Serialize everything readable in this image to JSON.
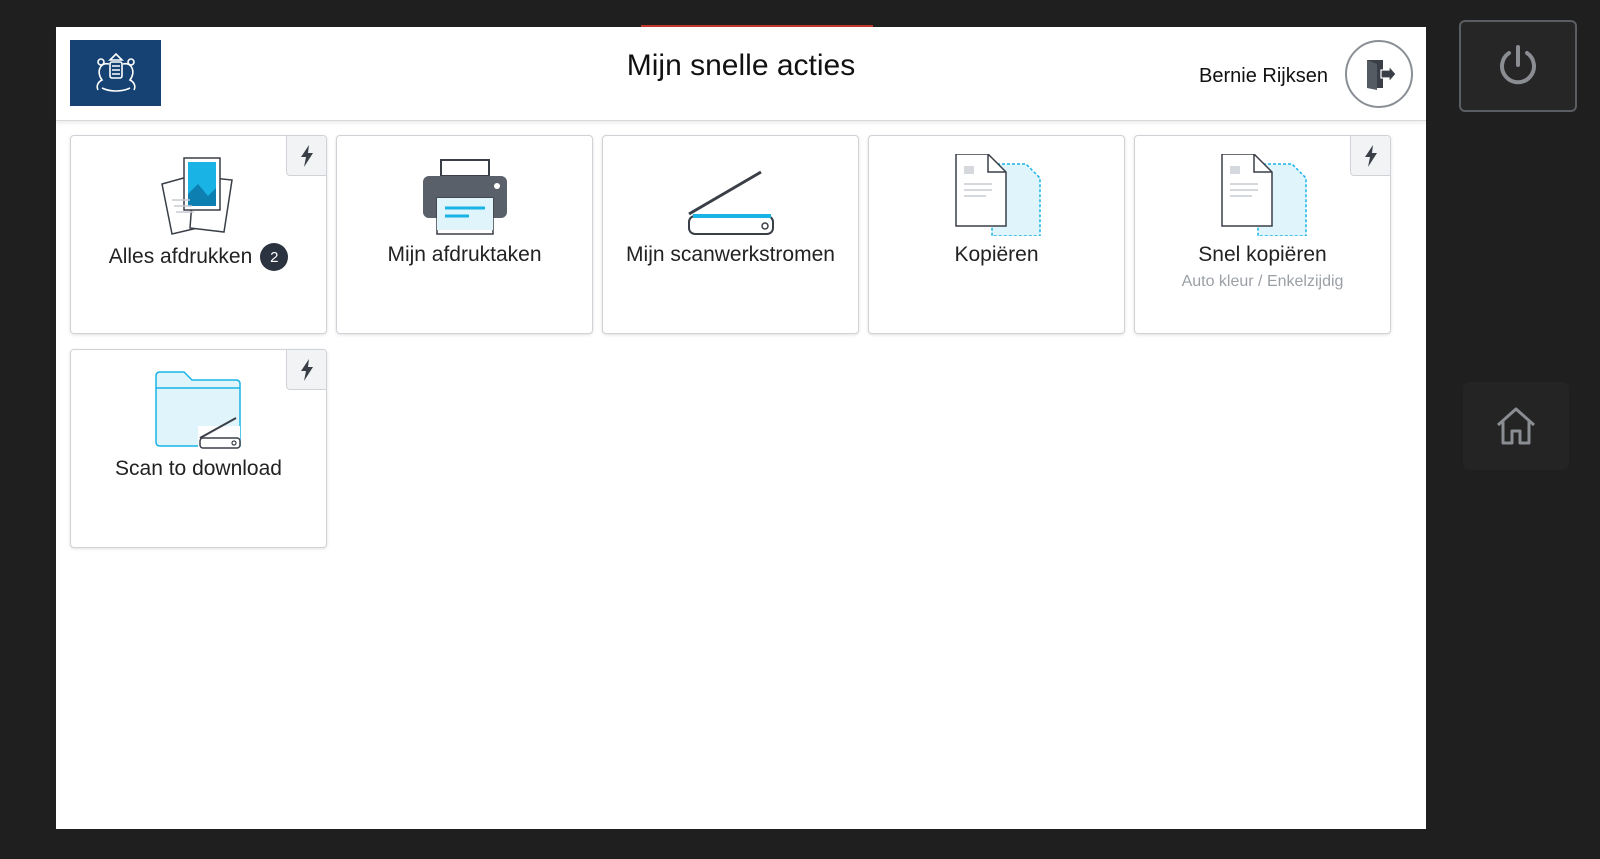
{
  "header": {
    "title": "Mijn snelle acties",
    "user_name": "Bernie Rijksen",
    "logo_icon": "coat-of-arms-icon",
    "logout_icon": "logout-icon"
  },
  "tiles": [
    {
      "label": "Alles afdrukken",
      "badge": "2",
      "icon": "print-all-icon",
      "quick": true
    },
    {
      "label": "Mijn afdruktaken",
      "icon": "printer-icon",
      "quick": false
    },
    {
      "label": "Mijn scanwerkstromen",
      "icon": "scanner-icon",
      "quick": false
    },
    {
      "label": "Kopiëren",
      "icon": "copy-icon",
      "quick": false
    },
    {
      "label": "Snel kopiëren",
      "sublabel": "Auto kleur / Enkelzijdig",
      "icon": "copy-icon",
      "quick": true
    },
    {
      "label": "Scan to download",
      "icon": "folder-scan-icon",
      "quick": true
    }
  ],
  "side_buttons": {
    "power_icon": "power-icon",
    "home_icon": "home-icon"
  },
  "colors": {
    "brand_blue": "#154273",
    "accent_cyan": "#1ab3e6",
    "badge_bg": "#2c3340"
  }
}
